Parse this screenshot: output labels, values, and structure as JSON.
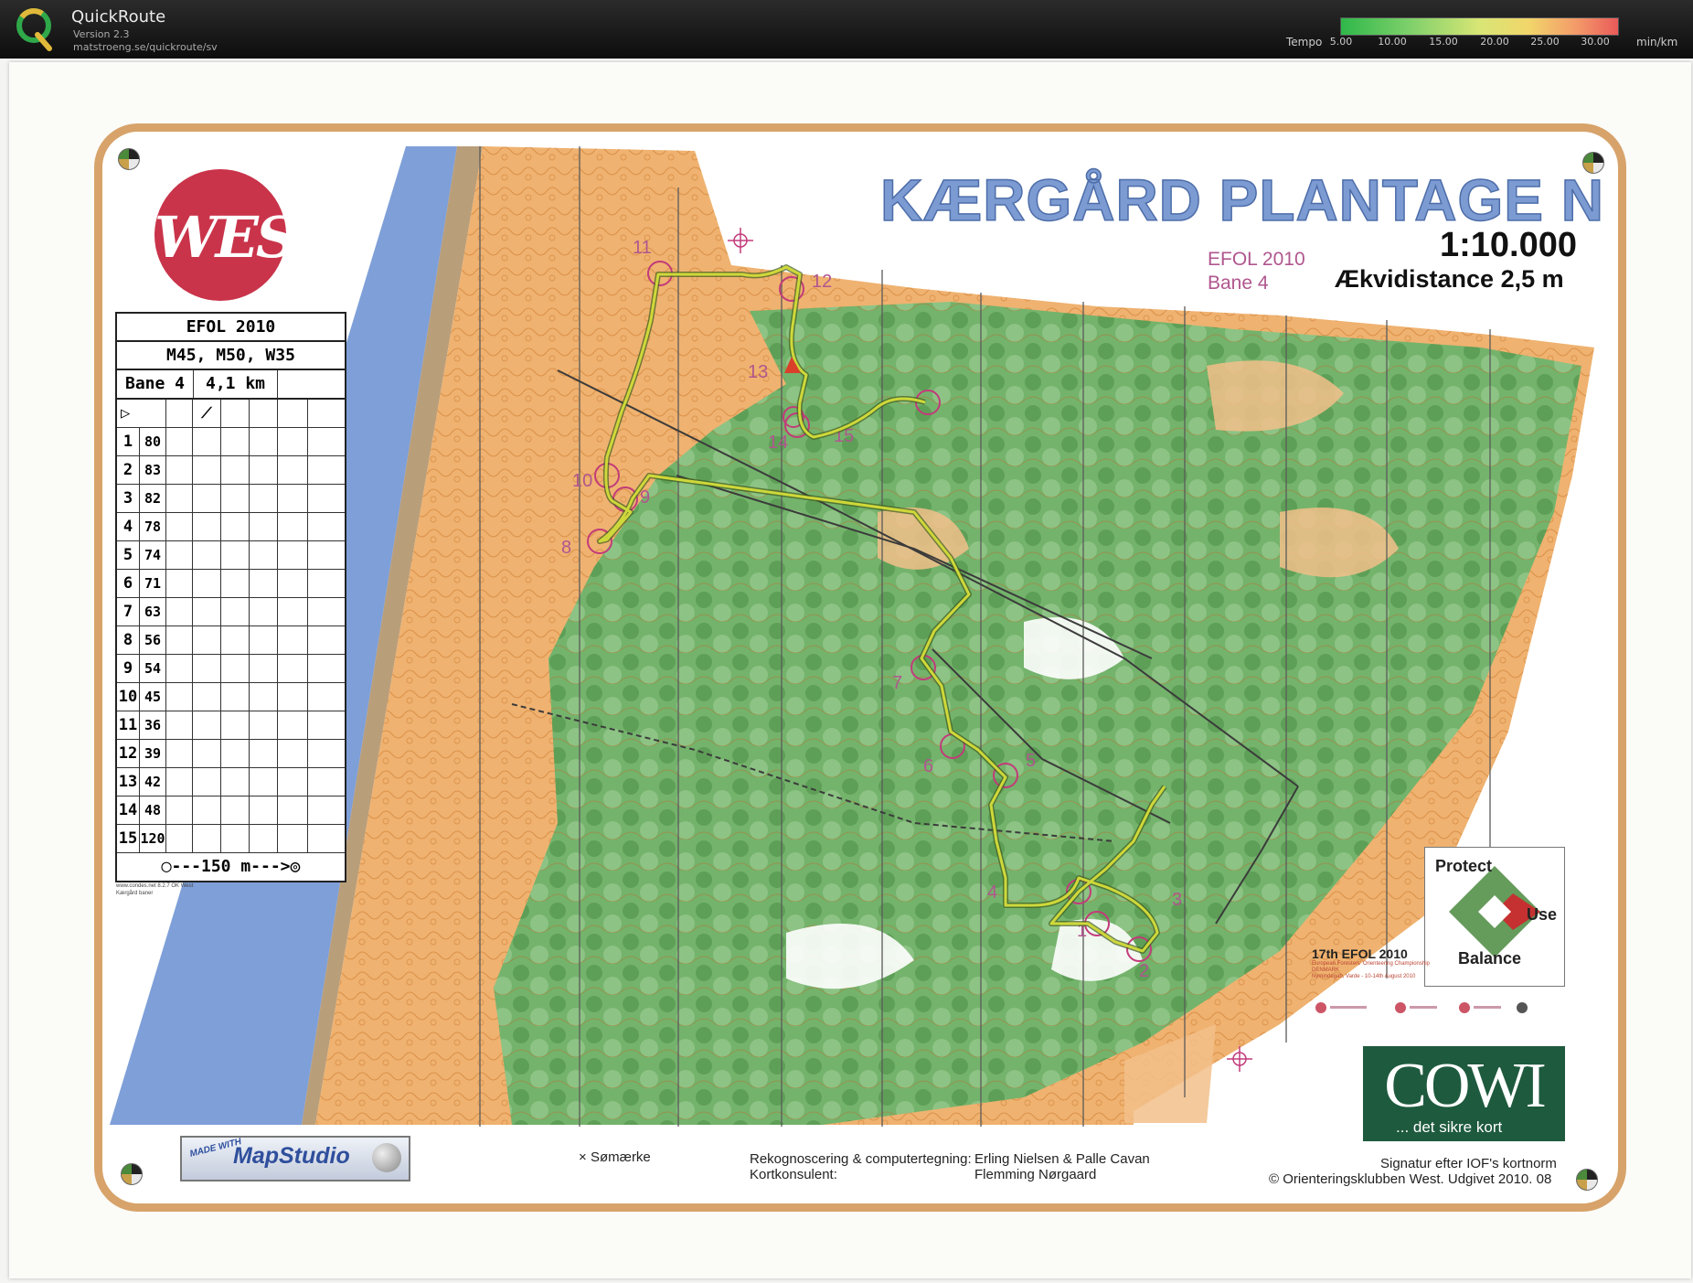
{
  "app": {
    "name": "QuickRoute",
    "version": "Version 2.3",
    "url": "matstroeng.se/quickroute/sv"
  },
  "tempo_legend": {
    "label": "Tempo",
    "ticks": [
      "5.00",
      "10.00",
      "15.00",
      "20.00",
      "25.00",
      "30.00"
    ],
    "unit": "min/km",
    "colors": [
      "#2fb84a",
      "#7fd06b",
      "#d8e675",
      "#f2d56a",
      "#f39a69",
      "#ea5a5a"
    ]
  },
  "map": {
    "title": "KÆRGÅRD PLANTAGE N",
    "scale": "1:10.000",
    "equidistance": "Ækvidistance 2,5 m",
    "event": "EFOL 2010",
    "course": "Bane 4",
    "club_logo": "WEST",
    "control_numbers": [
      "1",
      "2",
      "3",
      "4",
      "5",
      "6",
      "7",
      "8",
      "9",
      "10",
      "11",
      "12",
      "13",
      "14",
      "15"
    ]
  },
  "description_sheet": {
    "event": "EFOL 2010",
    "classes": "M45, M50, W35",
    "course": "Bane 4",
    "length": "4,1 km",
    "rows": [
      {
        "n": "1",
        "code": "80"
      },
      {
        "n": "2",
        "code": "83"
      },
      {
        "n": "3",
        "code": "82"
      },
      {
        "n": "4",
        "code": "78"
      },
      {
        "n": "5",
        "code": "74"
      },
      {
        "n": "6",
        "code": "71"
      },
      {
        "n": "7",
        "code": "63"
      },
      {
        "n": "8",
        "code": "56"
      },
      {
        "n": "9",
        "code": "54"
      },
      {
        "n": "10",
        "code": "45"
      },
      {
        "n": "11",
        "code": "36"
      },
      {
        "n": "12",
        "code": "39"
      },
      {
        "n": "13",
        "code": "42"
      },
      {
        "n": "14",
        "code": "48"
      },
      {
        "n": "15",
        "code": "120"
      }
    ],
    "finish": "◯---150 m--->◎",
    "credit_line1": "www.condes.net 8.2.7 OK West",
    "credit_line2": "Kærgård baner"
  },
  "sponsors": {
    "protect": "Protect",
    "use": "Use",
    "balance": "Balance",
    "efol_badge": "17th EFOL 2010",
    "efol_sub1": "European Foresters' Orienteering Championship",
    "efol_sub2": "DENMARK",
    "efol_sub3": "Nymindegab, Varde - 10-14th August 2010",
    "cowi_name": "COWI",
    "cowi_tagline": "... det sikre kort",
    "mapstudio_made": "MADE WITH",
    "mapstudio_name": "MapStudio"
  },
  "footer": {
    "legend_item": "Sømærke",
    "credits_label1": "Rekognoscering & computertegning:",
    "credits_label2": "Kortkonsulent:",
    "credits_name1": "Erling Nielsen & Palle Cavan",
    "credits_name2": "Flemming Nørgaard",
    "copyright1": "Signatur efter IOF's kortnorm",
    "copyright2": "© Orienteringsklubben West. Udgivet 2010. 08"
  }
}
